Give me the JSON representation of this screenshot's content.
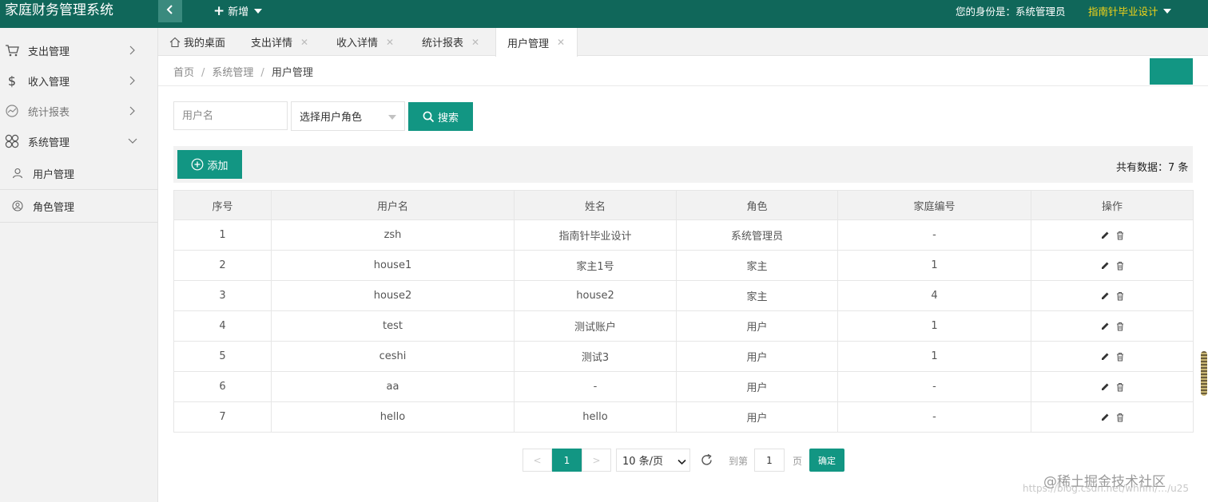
{
  "app": {
    "title": "家庭财务管理系统",
    "new_label": "新增",
    "identity_label": "您的身份是：系统管理员",
    "user_name": "指南针毕业设计",
    "colors": {
      "header": "#10675a",
      "accent": "#129683",
      "user_name": "#f5d417"
    }
  },
  "sidebar": {
    "items": [
      {
        "label": "支出管理",
        "icon": "cart-icon"
      },
      {
        "label": "收入管理",
        "icon": "dollar-icon"
      },
      {
        "label": "统计报表",
        "icon": "chart-icon"
      },
      {
        "label": "系统管理",
        "icon": "clover-icon"
      }
    ],
    "subitems": [
      {
        "label": "用户管理",
        "icon": "user-icon"
      },
      {
        "label": "角色管理",
        "icon": "role-icon"
      }
    ]
  },
  "tabs": [
    {
      "label": "我的桌面"
    },
    {
      "label": "支出详情"
    },
    {
      "label": "收入详情"
    },
    {
      "label": "统计报表"
    },
    {
      "label": "用户管理"
    }
  ],
  "breadcrumb": {
    "home": "首页",
    "section": "系统管理",
    "current": "用户管理",
    "separator": "/"
  },
  "search": {
    "username_placeholder": "用户名",
    "role_placeholder": "选择用户角色",
    "button": "搜索"
  },
  "toolbar": {
    "add_label": "添加",
    "total_label": "共有数据：7 条"
  },
  "table": {
    "headers": [
      "序号",
      "用户名",
      "姓名",
      "角色",
      "家庭编号",
      "操作"
    ],
    "rows": [
      {
        "id": "1",
        "username": "zsh",
        "name": "指南针毕业设计",
        "role": "系统管理员",
        "family": "-"
      },
      {
        "id": "2",
        "username": "house1",
        "name": "家主1号",
        "role": "家主",
        "family": "1"
      },
      {
        "id": "3",
        "username": "house2",
        "name": "house2",
        "role": "家主",
        "family": "4"
      },
      {
        "id": "4",
        "username": "test",
        "name": "测试账户",
        "role": "用户",
        "family": "1"
      },
      {
        "id": "5",
        "username": "ceshi",
        "name": "测试3",
        "role": "用户",
        "family": "1"
      },
      {
        "id": "6",
        "username": "aa",
        "name": "-",
        "role": "用户",
        "family": "-"
      },
      {
        "id": "7",
        "username": "hello",
        "name": "hello",
        "role": "用户",
        "family": "-"
      }
    ]
  },
  "pagination": {
    "prev": "<",
    "current": "1",
    "next": ">",
    "per_page": "10 条/页",
    "goto_label": "到第",
    "page_value": "1",
    "page_unit": "页",
    "confirm": "确定"
  },
  "watermark": {
    "url": "https://blog.csdn.net/whhm/…/u25",
    "site": "@稀土掘金技术社区"
  }
}
